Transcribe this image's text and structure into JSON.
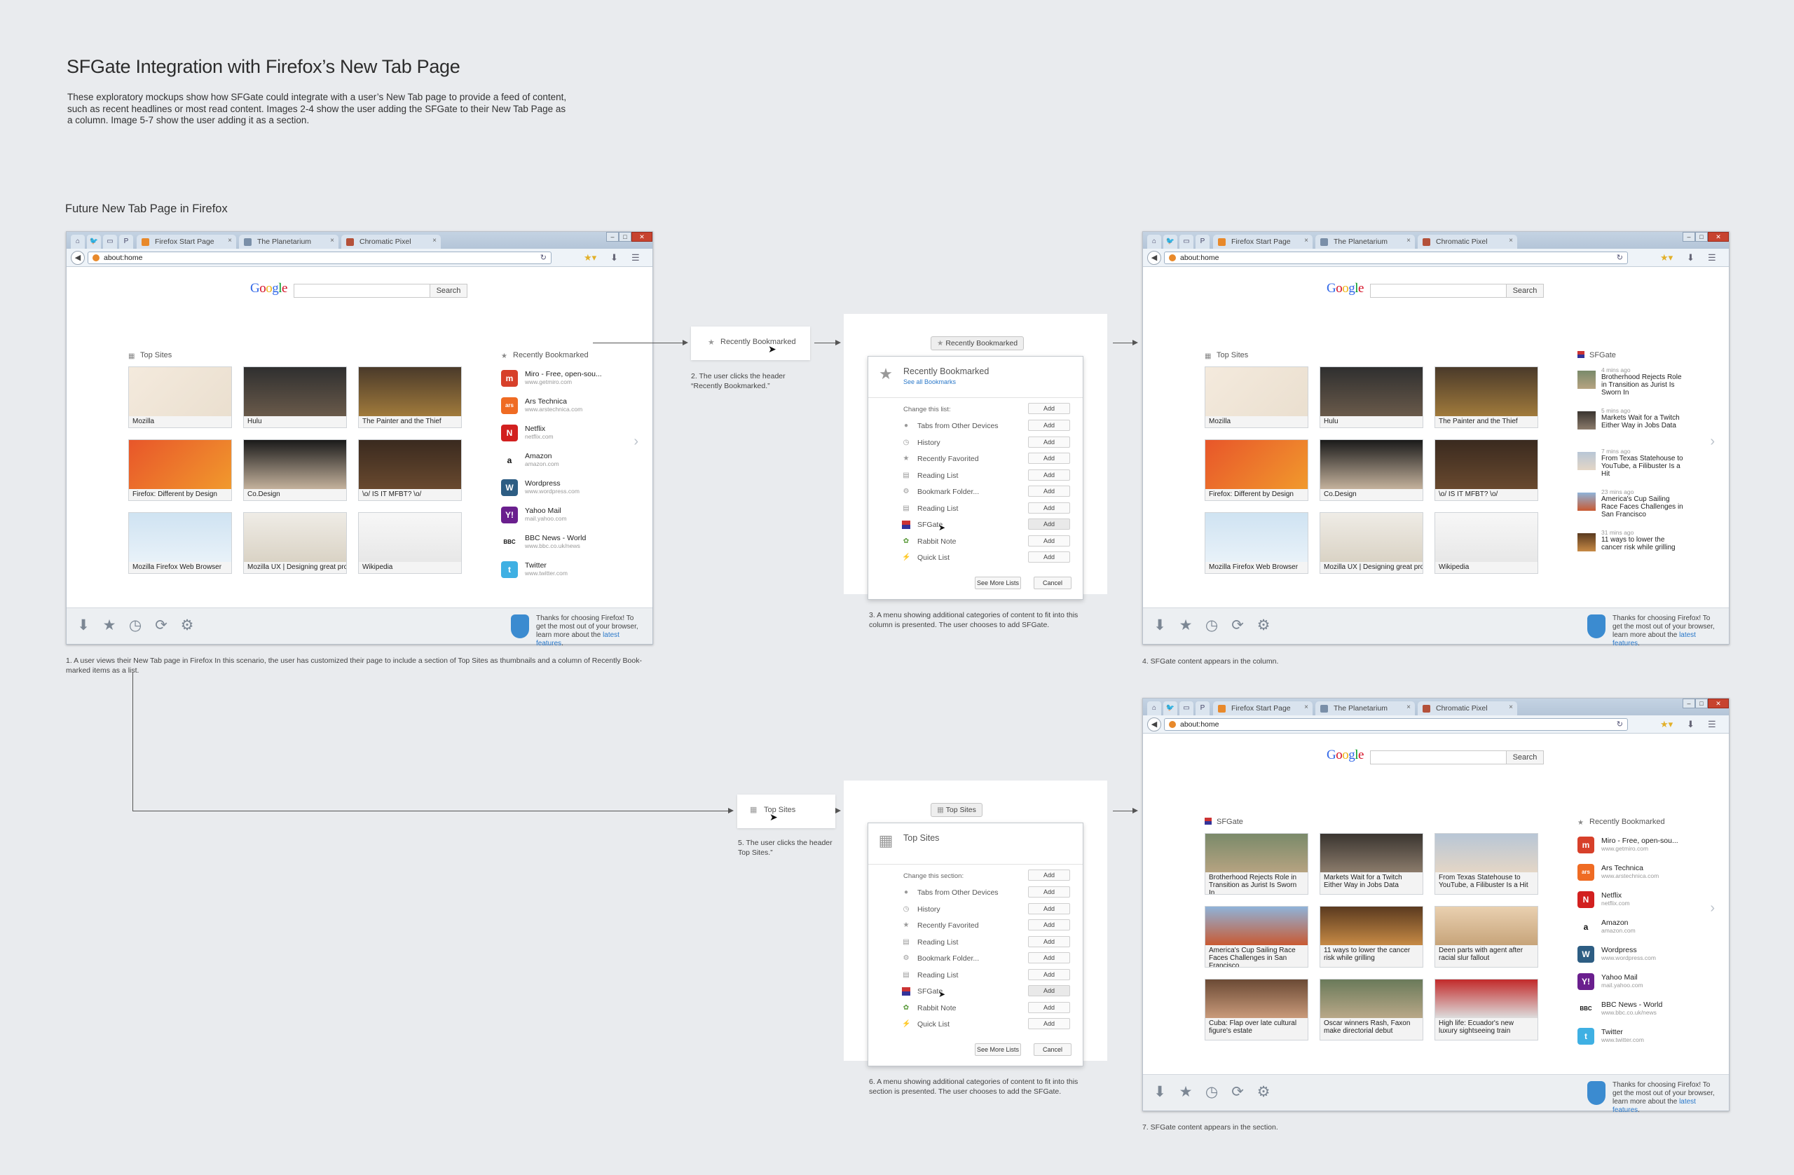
{
  "title": "SFGate Integration with Firefox’s New Tab Page",
  "intro": [
    "These exploratory mockups show how SFGate could integrate with a user’s New Tab page to provide a feed of content,",
    "such as recent headlines or most read content.  Images 2-4 show the user adding the SFGate to their New Tab Page as",
    "a column.  Image 5-7 show the user adding it as a section."
  ],
  "section_heading": "Future New Tab Page in Firefox",
  "browser": {
    "tabs": [
      "Firefox Start Page",
      "The Planetarium",
      "Chromatic Pixel"
    ],
    "url": "about:home",
    "google_logo": "Google",
    "search_button": "Search",
    "footer_msg": "Thanks for choosing Firefox! To get the most out of your browser, learn more about the ",
    "footer_link": "latest features",
    "footer_end": "."
  },
  "top_sites_label": "Top Sites",
  "recently_bookmarked_label": "Recently Bookmarked",
  "sfgate_label": "SFGate",
  "top_sites": [
    "Mozilla",
    "Hulu",
    "The Painter and the Thief",
    "Firefox: Different by Design",
    "Co.Design",
    "\\o/ IS IT MFBT? \\o/",
    "Mozilla Firefox Web Browser",
    "Mozilla UX | Designing great pro",
    "Wikipedia"
  ],
  "bookmarks": [
    {
      "title": "Miro - Free, open-sou...",
      "url": "www.getmiro.com",
      "icon": "m",
      "color": "#d7402a"
    },
    {
      "title": "Ars Technica",
      "url": "www.arstechnica.com",
      "icon": "ars",
      "color": "#ef6b23"
    },
    {
      "title": "Netflix",
      "url": "netflix.com",
      "icon": "N",
      "color": "#d2201f"
    },
    {
      "title": "Amazon",
      "url": "amazon.com",
      "icon": "a",
      "color": "#ffffff"
    },
    {
      "title": "Wordpress",
      "url": "www.wordpress.com",
      "icon": "W",
      "color": "#2d5d83"
    },
    {
      "title": "Yahoo Mail",
      "url": "mail.yahoo.com",
      "icon": "Y!",
      "color": "#6a1f8e"
    },
    {
      "title": "BBC News - World",
      "url": "www.bbc.co.uk/news",
      "icon": "BBC",
      "color": "#ffffff"
    },
    {
      "title": "Twitter",
      "url": "www.twitter.com",
      "icon": "t",
      "color": "#3fb0e3"
    }
  ],
  "sfgate_items": [
    {
      "ago": "4 mins ago",
      "title": "Brotherhood Rejects Role in Transition as Jurist Is Sworn In"
    },
    {
      "ago": "5 mins ago",
      "title": "Markets Wait for a Twitch Either Way in Jobs Data"
    },
    {
      "ago": "7 mins ago",
      "title": "From Texas Statehouse to YouTube, a Filibuster Is a Hit"
    },
    {
      "ago": "23 mins ago",
      "title": "America's Cup Sailing Race Faces Challenges in San Francisco"
    },
    {
      "ago": "31 mins ago",
      "title": "11 ways to lower the cancer risk while grilling"
    }
  ],
  "news_section": [
    "Brotherhood Rejects Role in Transition as Jurist Is Sworn In",
    "Markets Wait for a Twitch Either Way in Jobs Data",
    "From Texas Statehouse to YouTube, a Filibuster Is a Hit",
    "America's Cup Sailing Race Faces Challenges in San Francisco",
    "11 ways to lower the cancer risk while grilling",
    "Deen parts with agent after racial slur fallout",
    "Cuba: Flap over late cultural figure's estate",
    "Oscar winners Rash, Faxon make directorial debut",
    "High life: Ecuador's new luxury sightseeing train"
  ],
  "popup_rb": {
    "title": "Recently Bookmarked",
    "sub": "See all Bookmarks",
    "change": "Change this list:"
  },
  "popup_ts": {
    "title": "Top Sites",
    "change": "Change this section:"
  },
  "popup_rows": [
    "Tabs from Other Devices",
    "History",
    "Recently Favorited",
    "Reading List",
    "Bookmark Folder...",
    "Reading List",
    "SFGate",
    "Rabbit Note",
    "Quick List"
  ],
  "add_label": "Add",
  "see_more": "See More Lists",
  "cancel": "Cancel",
  "captions": {
    "c1": "1. A user views their New Tab page in Firefox  In this scenario, the user has customized their page to include a section of Top Sites as thumbnails and a column of Recently Book-marked items as a list.",
    "c2": "2. The user clicks the header “Recently Bookmarked.”",
    "c3": "3. A menu showing additional categories of content to fit into this column is presented.  The user chooses to add SFGate.",
    "c4": "4. SFGate content appears in the column.",
    "c5": "5. The user clicks the header Top Sites.”",
    "c6": "6. A menu showing additional categories of content to fit into this section is presented.  The user chooses to add the SFGate.",
    "c7": "7. SFGate content appears in the section."
  },
  "colors": {
    "firefox_blue": "#2a78c9",
    "close_red": "#c7432f",
    "google_blue": "#3369e8",
    "google_red": "#d50f25",
    "google_yellow": "#eeb211",
    "google_green": "#009925"
  }
}
